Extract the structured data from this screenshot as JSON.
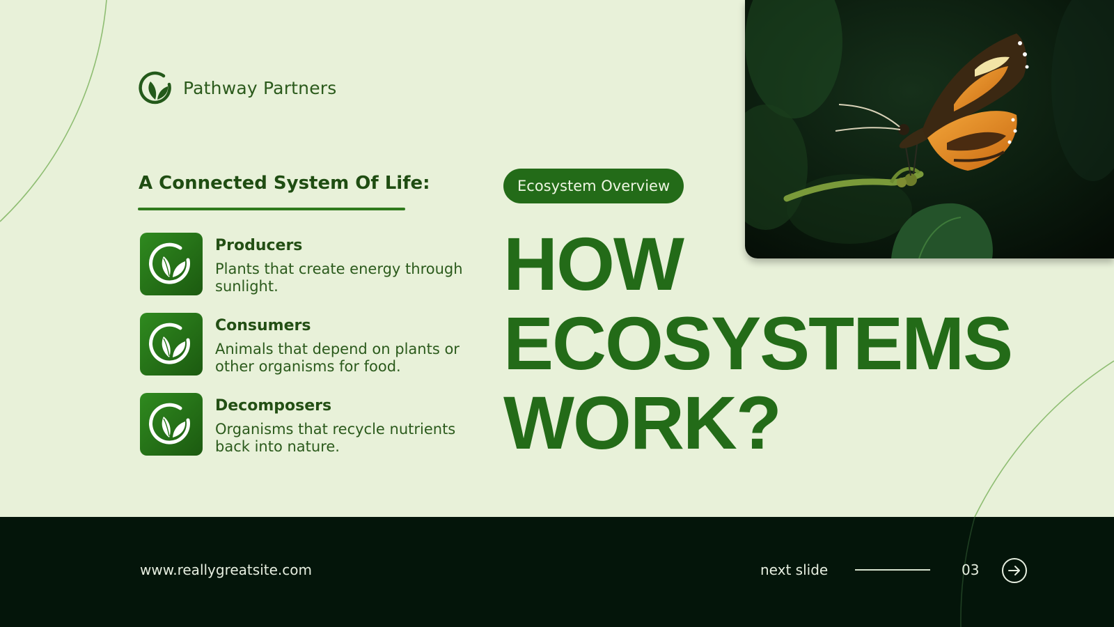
{
  "brand": {
    "name": "Pathway Partners",
    "icon": "leaf-logo-icon"
  },
  "intro": {
    "heading": "A Connected System Of Life:",
    "items": [
      {
        "title": "Producers",
        "description": "Plants that create energy through sunlight.",
        "icon": "leaf-icon"
      },
      {
        "title": "Consumers",
        "description": "Animals that depend on plants or other organisms for food.",
        "icon": "leaf-icon"
      },
      {
        "title": "Decomposers",
        "description": "Organisms that recycle nutrients back into nature.",
        "icon": "leaf-icon"
      }
    ]
  },
  "hero": {
    "badge": "Ecosystem Overview",
    "headline_lines": [
      "HOW",
      "ECOSYSTEMS",
      "WORK?"
    ],
    "photo_subject": "butterfly-on-plant-photo"
  },
  "footer": {
    "url": "www.reallygreatsite.com",
    "next_label": "next slide",
    "page_number": "03",
    "next_icon": "arrow-right-circle-icon"
  },
  "colors": {
    "background": "#e8f1d9",
    "primary_green": "#236b18",
    "dark_green": "#1f4d12",
    "footer_background": "#04150a",
    "footer_text": "#e6eee0"
  }
}
